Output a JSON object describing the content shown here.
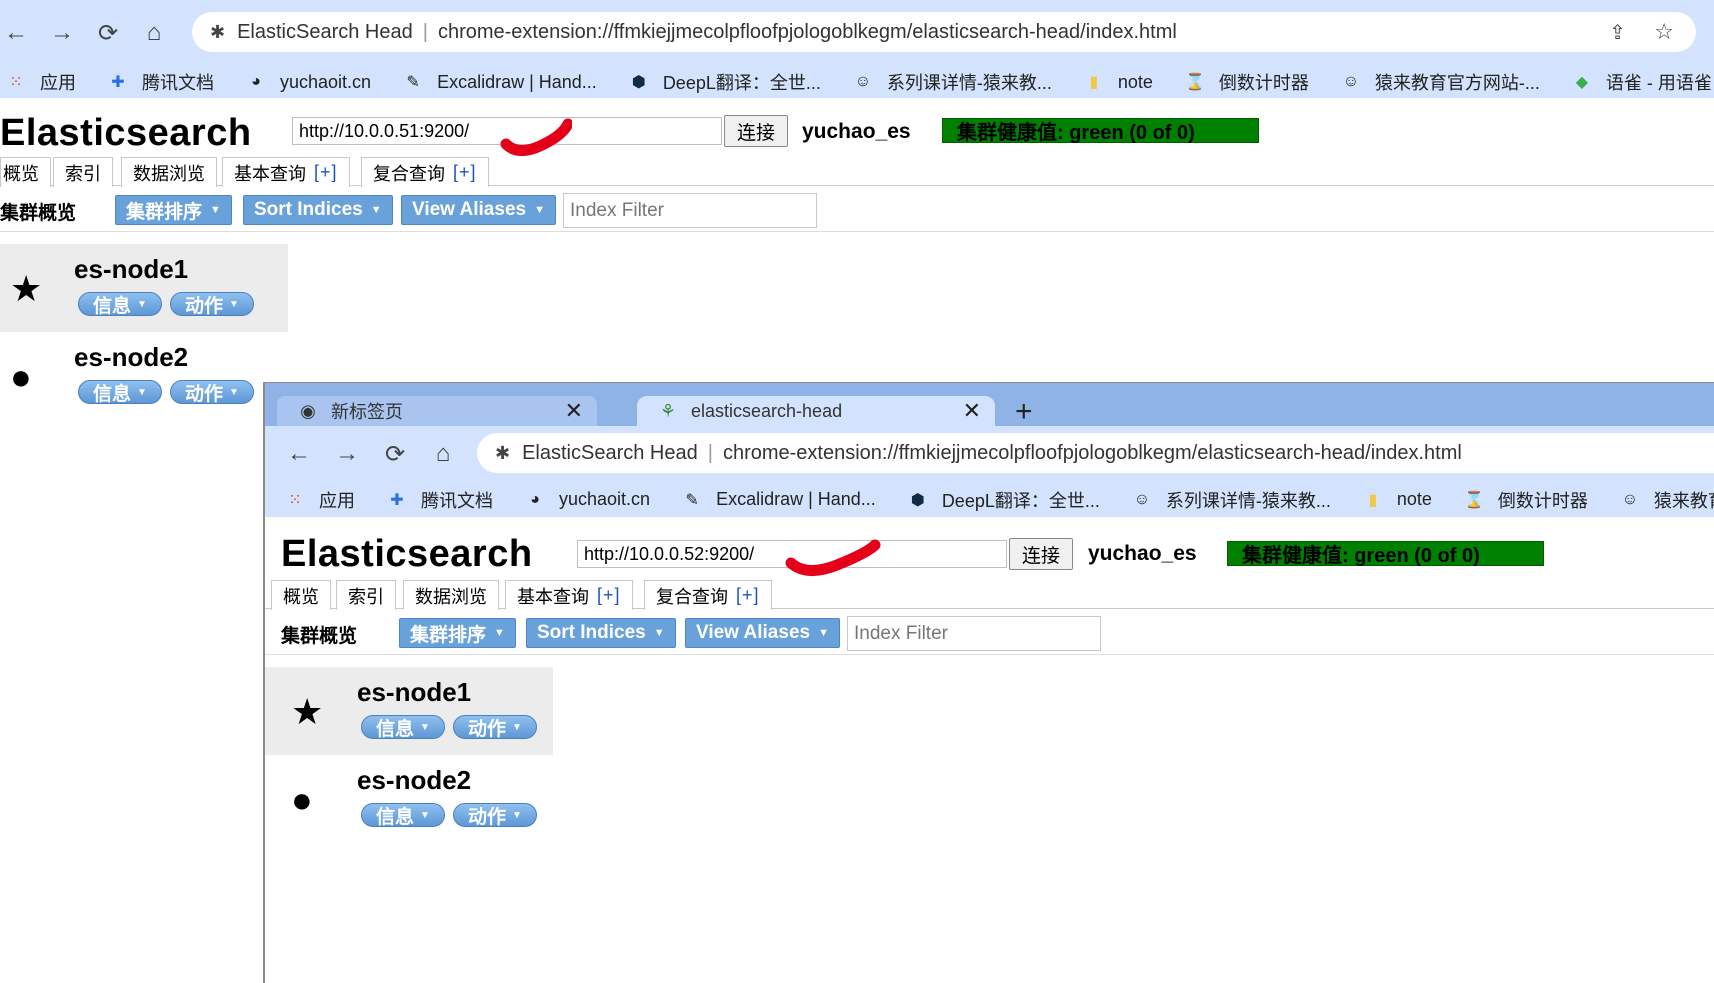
{
  "back_window": {
    "omnibox": {
      "site_title": "ElasticSearch Head",
      "url": "chrome-extension://ffmkiejjmecolpfloofpjologoblkegm/elasticsearch-head/index.html"
    },
    "bookmarks": [
      "应用",
      "腾讯文档",
      "yuchaoit.cn",
      "Excalidraw | Hand...",
      "DeepL翻译：全世...",
      "系列课详情-猿来教...",
      "note",
      "倒数计时器",
      "猿来教育官方网站-...",
      "语雀 - 用语雀，构"
    ],
    "app": {
      "title": "Elasticsearch",
      "connect_url": "http://10.0.0.51:9200/",
      "connect_label": "连接",
      "cluster_name": "yuchao_es",
      "health": "集群健康值: green (0 of 0)",
      "tabs": [
        "概览",
        "索引",
        "数据浏览",
        "基本查询",
        "复合查询"
      ],
      "tab_plus": "[+]",
      "overview_title": "集群概览",
      "buttons": [
        "集群排序",
        "Sort Indices",
        "View Aliases"
      ],
      "filter_placeholder": "Index Filter",
      "nodes": [
        {
          "name": "es-node1",
          "info": "信息",
          "action": "动作"
        },
        {
          "name": "es-node2",
          "info": "信息",
          "action": "动作"
        }
      ]
    }
  },
  "front_window": {
    "tabs": [
      {
        "title": "新标签页"
      },
      {
        "title": "elasticsearch-head"
      }
    ],
    "omnibox": {
      "site_title": "ElasticSearch Head",
      "url": "chrome-extension://ffmkiejjmecolpfloofpjologoblkegm/elasticsearch-head/index.html"
    },
    "bookmarks": [
      "应用",
      "腾讯文档",
      "yuchaoit.cn",
      "Excalidraw | Hand...",
      "DeepL翻译：全世...",
      "系列课详情-猿来教...",
      "note",
      "倒数计时器",
      "猿来教育官"
    ],
    "app": {
      "title": "Elasticsearch",
      "connect_url": "http://10.0.0.52:9200/",
      "connect_label": "连接",
      "cluster_name": "yuchao_es",
      "health": "集群健康值: green (0 of 0)",
      "tabs": [
        "概览",
        "索引",
        "数据浏览",
        "基本查询",
        "复合查询"
      ],
      "tab_plus": "[+]",
      "overview_title": "集群概览",
      "buttons": [
        "集群排序",
        "Sort Indices",
        "View Aliases"
      ],
      "filter_placeholder": "Index Filter",
      "nodes": [
        {
          "name": "es-node1",
          "info": "信息",
          "action": "动作"
        },
        {
          "name": "es-node2",
          "info": "信息",
          "action": "动作"
        }
      ]
    }
  },
  "colors": {
    "chrome_toolbar": "#d3e3fd",
    "tabstrip": "#8fb3e6",
    "health_green": "#008000",
    "button_blue": "#69a1db",
    "red_mark": "#e5001a"
  },
  "icons": {
    "back": "arrow-left-icon",
    "forward": "arrow-right-icon",
    "reload": "reload-icon",
    "home": "home-icon",
    "extension": "puzzle-icon",
    "share": "share-icon",
    "bookmark": "star-icon",
    "master_node": "star-icon",
    "data_node": "circle-icon"
  }
}
